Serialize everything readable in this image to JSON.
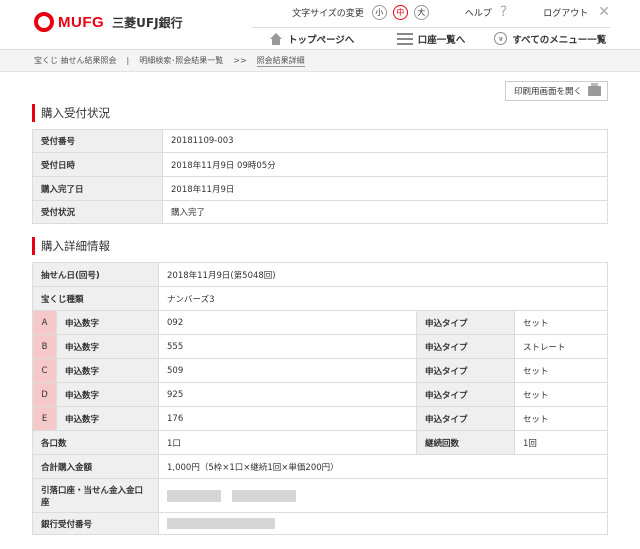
{
  "header": {
    "logo_text": "MUFG",
    "bank_name": "三菱UFJ銀行",
    "font_size_label": "文字サイズの変更",
    "font_sizes": [
      "小",
      "中",
      "大"
    ],
    "help": "ヘルプ",
    "logout": "ログアウト"
  },
  "nav": {
    "home": "トップページへ",
    "accounts": "口座一覧へ",
    "all_menu": "すべてのメニュー一覧"
  },
  "breadcrumb": [
    "宝くじ 抽せん結果照会",
    "|",
    "明細検索･照会結果一覧",
    ">>",
    "照会結果詳細"
  ],
  "print_button": "印刷用画面を開く",
  "section1": {
    "title": "購入受付状況",
    "rows": [
      {
        "label": "受付番号",
        "value": "20181109-003"
      },
      {
        "label": "受付日時",
        "value": "2018年11月9日 09時05分"
      },
      {
        "label": "購入完了日",
        "value": "2018年11月9日"
      },
      {
        "label": "受付状況",
        "value": "購入完了"
      }
    ]
  },
  "section2": {
    "title": "購入詳細情報",
    "draw_date_label": "抽せん日(回号)",
    "draw_date": "2018年11月9日(第5048回)",
    "lottery_type_label": "宝くじ種類",
    "lottery_type": "ナンバーズ3",
    "entries": [
      {
        "letter": "A",
        "num_label": "申込数字",
        "number": "092",
        "type_label": "申込タイプ",
        "type": "セット"
      },
      {
        "letter": "B",
        "num_label": "申込数字",
        "number": "555",
        "type_label": "申込タイプ",
        "type": "ストレート"
      },
      {
        "letter": "C",
        "num_label": "申込数字",
        "number": "509",
        "type_label": "申込タイプ",
        "type": "セット"
      },
      {
        "letter": "D",
        "num_label": "申込数字",
        "number": "925",
        "type_label": "申込タイプ",
        "type": "セット"
      },
      {
        "letter": "E",
        "num_label": "申込数字",
        "number": "176",
        "type_label": "申込タイプ",
        "type": "セット"
      }
    ],
    "count_label": "各口数",
    "count": "1口",
    "continue_label": "継続回数",
    "continue": "1回",
    "total_label": "合計購入金額",
    "total": "1,000円（5枠×1口×継続1回×単価200円）",
    "account_label": "引落口座・当せん金入金口座",
    "receipt_label": "銀行受付番号"
  }
}
